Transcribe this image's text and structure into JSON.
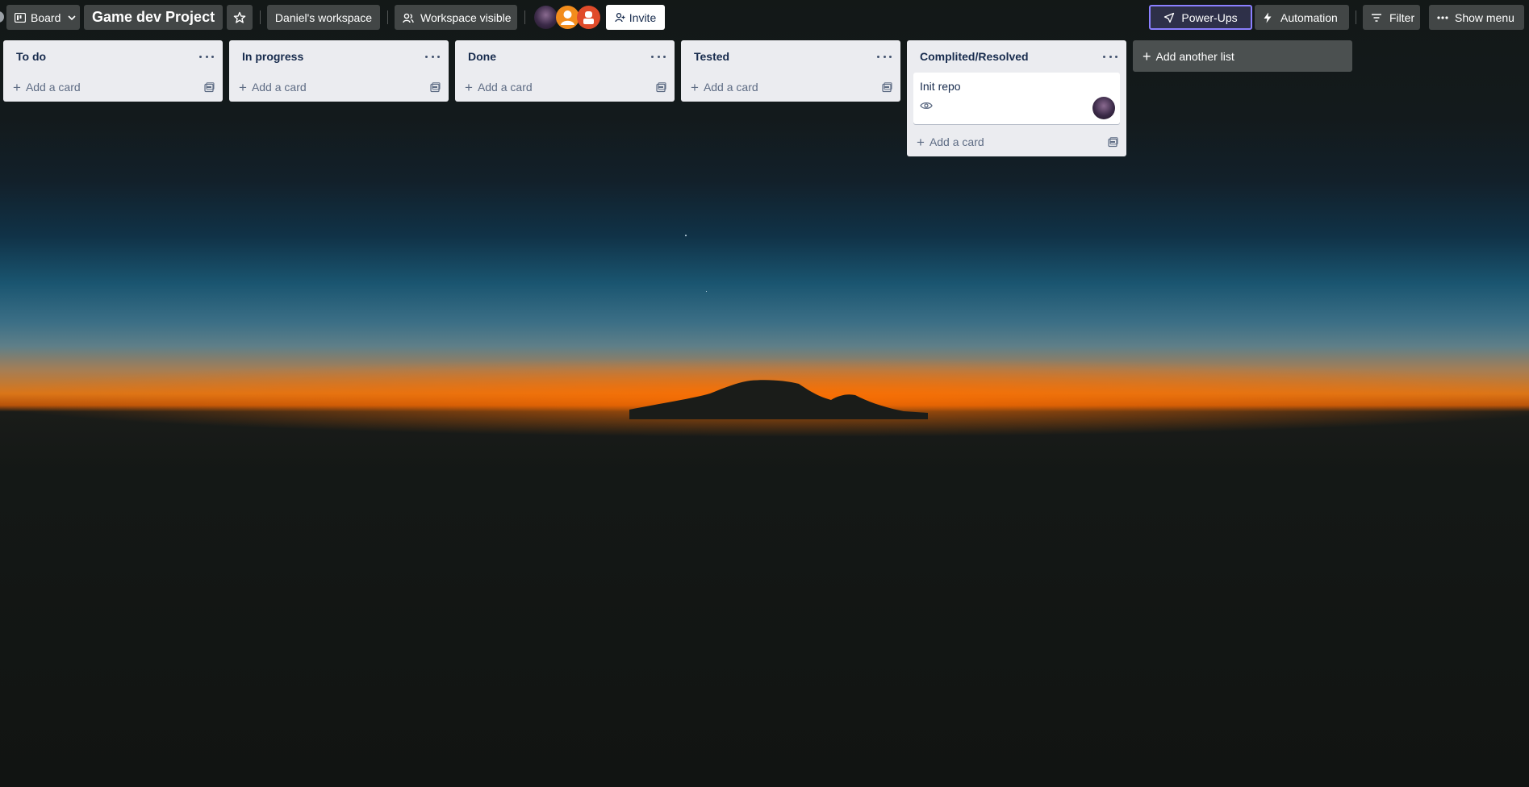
{
  "header": {
    "view_label": "Board",
    "board_title": "Game dev Project",
    "workspace_label": "Daniel's workspace",
    "visibility_label": "Workspace visible",
    "invite_label": "Invite",
    "powerups_label": "Power-Ups",
    "automation_label": "Automation",
    "filter_label": "Filter",
    "menu_label": "Show menu"
  },
  "lists": [
    {
      "title": "To do",
      "add_card_label": "Add a card"
    },
    {
      "title": "In progress",
      "add_card_label": "Add a card"
    },
    {
      "title": "Done",
      "add_card_label": "Add a card"
    },
    {
      "title": "Tested",
      "add_card_label": "Add a card"
    },
    {
      "title": "Complited/Resolved",
      "add_card_label": "Add a card",
      "cards": [
        {
          "title": "Init repo"
        }
      ]
    }
  ],
  "add_list_label": "Add another list",
  "colors": {
    "list_bg": "#ebecf0",
    "powerups_border": "#8a7fff",
    "avatar_orange": "#f28c1c",
    "avatar_red": "#e04b2a"
  }
}
